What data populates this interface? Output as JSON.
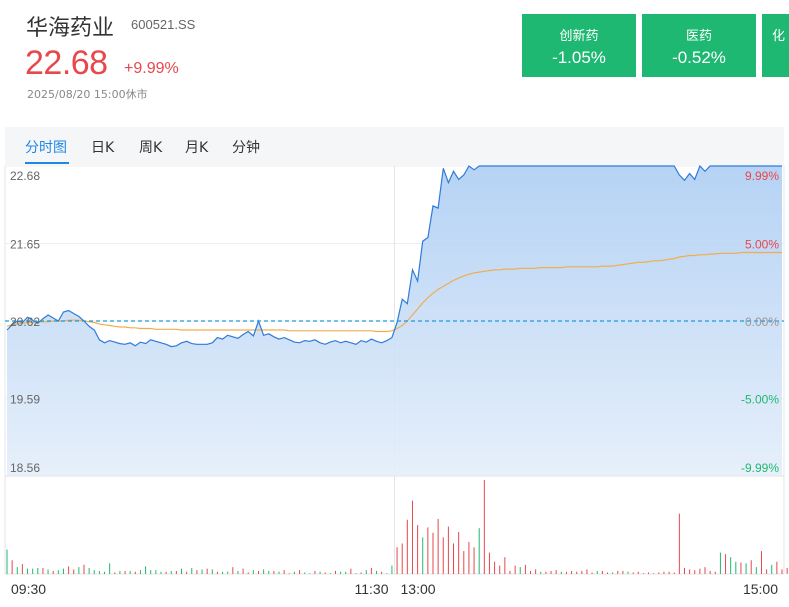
{
  "stock": {
    "name": "华海药业",
    "code": "600521.SS",
    "price": "22.68",
    "change_pct": "+9.99%",
    "status_time": "2025/08/20 15:00休市",
    "color_up": "#e8474b",
    "color_down": "#1fb872"
  },
  "sectors": [
    {
      "name": "创新药",
      "change": "-1.05%"
    },
    {
      "name": "医药",
      "change": "-0.52%"
    },
    {
      "name": "化",
      "change": ""
    }
  ],
  "tabs": [
    {
      "label": "分时图",
      "active": true
    },
    {
      "label": "日K",
      "active": false
    },
    {
      "label": "周K",
      "active": false
    },
    {
      "label": "月K",
      "active": false
    },
    {
      "label": "分钟",
      "active": false
    }
  ],
  "chart_data": {
    "type": "line",
    "prev_close": 20.62,
    "ylim": [
      18.56,
      22.68
    ],
    "y_ticks": [
      "22.68",
      "21.65",
      "20.62",
      "19.59",
      "18.56"
    ],
    "pct_ticks": [
      "9.99%",
      "5.00%",
      "0.00%",
      "-5.00%",
      "-9.99%"
    ],
    "x_ticks": [
      "09:30",
      "11:30",
      "13:00",
      "15:00"
    ],
    "series": [
      {
        "role": "price",
        "color": "#2f7bd8",
        "values": [
          20.5,
          20.57,
          20.62,
          20.6,
          20.67,
          20.63,
          20.59,
          20.65,
          20.7,
          20.66,
          20.62,
          20.74,
          20.76,
          20.72,
          20.68,
          20.62,
          20.55,
          20.5,
          20.37,
          20.33,
          20.36,
          20.34,
          20.32,
          20.31,
          20.33,
          20.29,
          20.34,
          20.32,
          20.37,
          20.35,
          20.33,
          20.31,
          20.28,
          20.29,
          20.33,
          20.35,
          20.32,
          20.31,
          20.31,
          20.31,
          20.33,
          20.4,
          20.38,
          20.43,
          20.41,
          20.39,
          20.44,
          20.48,
          20.42,
          20.62,
          20.43,
          20.45,
          20.41,
          20.38,
          20.4,
          20.37,
          20.34,
          20.33,
          20.36,
          20.35,
          20.37,
          20.33,
          20.31,
          20.34,
          20.36,
          20.33,
          20.35,
          20.33,
          20.31,
          20.36,
          20.34,
          20.38,
          20.35,
          20.33,
          20.36,
          20.4,
          20.6,
          20.91,
          20.85,
          21.3,
          21.15,
          21.68,
          21.73,
          22.15,
          22.12,
          22.65,
          22.46,
          22.61,
          22.5,
          22.56,
          22.68,
          22.63,
          22.68,
          22.68,
          22.68,
          22.68,
          22.68,
          22.68,
          22.68,
          22.68,
          22.68,
          22.68,
          22.68,
          22.68,
          22.68,
          22.68,
          22.68,
          22.68,
          22.68,
          22.68,
          22.68,
          22.68,
          22.68,
          22.68,
          22.68,
          22.68,
          22.68,
          22.68,
          22.68,
          22.68,
          22.68,
          22.68,
          22.68,
          22.68,
          22.68,
          22.68,
          22.68,
          22.68,
          22.68,
          22.68,
          22.68,
          22.56,
          22.49,
          22.58,
          22.5,
          22.68,
          22.61,
          22.68,
          22.68,
          22.68,
          22.68,
          22.68,
          22.68,
          22.68,
          22.68,
          22.68,
          22.68,
          22.68,
          22.68,
          22.68,
          22.68,
          22.68
        ]
      },
      {
        "role": "average",
        "color": "#f0ad4e",
        "values": [
          20.55,
          20.57,
          20.58,
          20.59,
          20.6,
          20.6,
          20.61,
          20.61,
          20.61,
          20.62,
          20.62,
          20.62,
          20.63,
          20.63,
          20.63,
          20.62,
          20.61,
          20.6,
          20.58,
          20.57,
          20.56,
          20.55,
          20.54,
          20.54,
          20.53,
          20.53,
          20.52,
          20.52,
          20.52,
          20.51,
          20.51,
          20.51,
          20.51,
          20.51,
          20.5,
          20.5,
          20.5,
          20.5,
          20.5,
          20.5,
          20.5,
          20.5,
          20.5,
          20.5,
          20.5,
          20.5,
          20.5,
          20.5,
          20.5,
          20.5,
          20.5,
          20.5,
          20.5,
          20.5,
          20.5,
          20.49,
          20.49,
          20.49,
          20.49,
          20.49,
          20.49,
          20.49,
          20.49,
          20.49,
          20.49,
          20.49,
          20.49,
          20.49,
          20.49,
          20.49,
          20.49,
          20.49,
          20.48,
          20.48,
          20.48,
          20.49,
          20.52,
          20.56,
          20.62,
          20.7,
          20.78,
          20.86,
          20.93,
          20.99,
          21.04,
          21.08,
          21.12,
          21.16,
          21.19,
          21.22,
          21.24,
          21.26,
          21.27,
          21.28,
          21.29,
          21.3,
          21.3,
          21.31,
          21.31,
          21.31,
          21.32,
          21.32,
          21.32,
          21.32,
          21.33,
          21.33,
          21.33,
          21.33,
          21.33,
          21.34,
          21.34,
          21.34,
          21.34,
          21.34,
          21.34,
          21.34,
          21.35,
          21.35,
          21.35,
          21.36,
          21.37,
          21.38,
          21.39,
          21.4,
          21.4,
          21.41,
          21.42,
          21.42,
          21.43,
          21.44,
          21.45,
          21.47,
          21.48,
          21.49,
          21.49,
          21.5,
          21.5,
          21.51,
          21.51,
          21.52,
          21.52,
          21.52,
          21.52,
          21.53,
          21.53,
          21.53,
          21.53,
          21.53,
          21.53,
          21.53,
          21.53,
          21.53
        ]
      }
    ],
    "volume": {
      "values": [
        32,
        18,
        9,
        13,
        7,
        7,
        8,
        8,
        6,
        4,
        5,
        7,
        10,
        6,
        9,
        12,
        8,
        5,
        4,
        3,
        14,
        2,
        4,
        4,
        4,
        3,
        5,
        10,
        5,
        5,
        3,
        3,
        4,
        4,
        7,
        3,
        8,
        5,
        6,
        7,
        6,
        3,
        3,
        3,
        9,
        4,
        7,
        2,
        5,
        4,
        6,
        4,
        4,
        3,
        5,
        1,
        3,
        5,
        2,
        1,
        4,
        3,
        2,
        1,
        4,
        3,
        3,
        7,
        1,
        2,
        5,
        8,
        4,
        3,
        1,
        11,
        35,
        40,
        71,
        96,
        64,
        48,
        61,
        54,
        72,
        48,
        62,
        40,
        55,
        30,
        42,
        35,
        60,
        123,
        28,
        16,
        11,
        22,
        4,
        11,
        9,
        12,
        4,
        6,
        3,
        3,
        4,
        5,
        3,
        3,
        4,
        3,
        4,
        6,
        2,
        4,
        4,
        2,
        2,
        4,
        4,
        3,
        2,
        3,
        1,
        2,
        1,
        2,
        3,
        3,
        2,
        79,
        8,
        6,
        5,
        7,
        9,
        4,
        3,
        28,
        26,
        22,
        16,
        15,
        14,
        18,
        9,
        30,
        6,
        12,
        16,
        6,
        8,
        3,
        4,
        5
      ],
      "colors": [
        "g",
        "r",
        "g",
        "r",
        "g",
        "g",
        "g",
        "r",
        "g",
        "r",
        "g",
        "g",
        "r",
        "r",
        "g",
        "r",
        "g",
        "g",
        "g",
        "g",
        "g",
        "r",
        "g",
        "r",
        "g",
        "r",
        "g",
        "g",
        "g",
        "g",
        "g",
        "r",
        "g",
        "r",
        "g",
        "r",
        "g",
        "r",
        "g",
        "r",
        "g",
        "r",
        "g",
        "g",
        "r",
        "g",
        "r",
        "r",
        "g",
        "r",
        "g",
        "g",
        "r",
        "g",
        "r",
        "r",
        "g",
        "r",
        "g",
        "g",
        "r",
        "g",
        "r",
        "g",
        "r",
        "g",
        "g",
        "r",
        "g",
        "r",
        "g",
        "r",
        "g",
        "r",
        "g",
        "g",
        "r",
        "r",
        "r",
        "r",
        "r",
        "g",
        "r",
        "r",
        "r",
        "r",
        "r",
        "r",
        "r",
        "r",
        "r",
        "r",
        "g",
        "r",
        "r",
        "r",
        "r",
        "r",
        "r",
        "r",
        "g",
        "r",
        "r",
        "r",
        "g",
        "r",
        "r",
        "r",
        "g",
        "r",
        "r",
        "r",
        "r",
        "r",
        "r",
        "g",
        "r",
        "r",
        "g",
        "r",
        "r",
        "g",
        "r",
        "r",
        "r",
        "r",
        "g",
        "r",
        "r",
        "r",
        "r",
        "r",
        "r",
        "r",
        "r",
        "r",
        "r",
        "r",
        "r",
        "g",
        "r",
        "g",
        "g",
        "r",
        "g",
        "r",
        "g",
        "r",
        "r",
        "g",
        "r",
        "r",
        "r",
        "r",
        "r"
      ]
    }
  }
}
